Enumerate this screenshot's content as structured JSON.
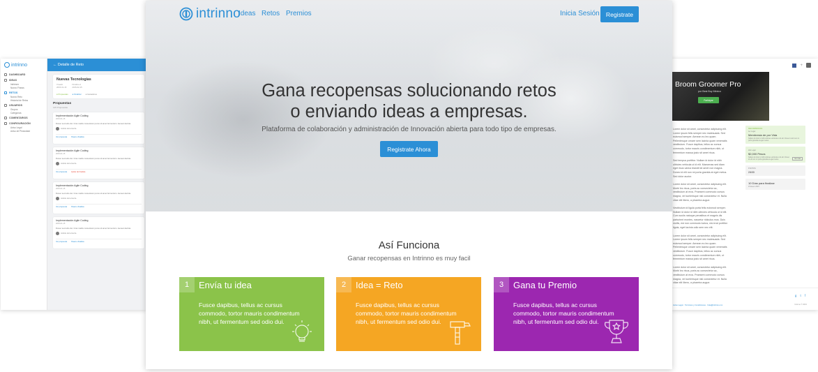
{
  "center": {
    "nav": {
      "logo": "intrinno",
      "links": [
        "Ideas",
        "Retos",
        "Premios"
      ],
      "login": "Inicia Sesión",
      "register": "Registrate"
    },
    "hero": {
      "title_line1": "Gana recopensas solucionando retos",
      "title_line2": "o enviando ideas a empresas.",
      "subtitle": "Plataforma de colaboración y administración de Innovación abierta para todo tipo de empresas.",
      "cta": "Registrate Ahora"
    },
    "how": {
      "title": "Así Funciona",
      "subtitle": "Ganar recopensas en Intrinno es muy facil",
      "steps": [
        {
          "num": "1",
          "title": "Envía tu idea",
          "desc": "Fusce dapibus, tellus ac cursus commodo, tortor mauris condimentum nibh, ut fermentum sed odio dui.",
          "color": "#8bc34a",
          "icon": "lightbulb-icon"
        },
        {
          "num": "2",
          "title": "Idea = Reto",
          "desc": "Fusce dapibus, tellus ac cursus commodo, tortor mauris condimentum nibh, ut fermentum sed odio dui.",
          "color": "#f5a623",
          "icon": "hammer-icon"
        },
        {
          "num": "3",
          "title": "Gana tu Premio",
          "desc": "Fusce dapibus, tellus ac cursus commodo, tortor mauris condimentum nibh, ut fermentum sed odio dui.",
          "color": "#9c27b0",
          "icon": "trophy-icon"
        }
      ]
    }
  },
  "left": {
    "logo": "intrinno",
    "menu": [
      {
        "label": "DASHBOARD",
        "subs": []
      },
      {
        "label": "IDEAS",
        "subs": [
          "Intrinsex",
          "Nuevo Fineas"
        ]
      },
      {
        "label": "RETOS",
        "subs": [
          "Nuevo Reto",
          "Historial de Retos"
        ],
        "active": true
      },
      {
        "label": "USUARIOS",
        "subs": [
          "Grupos",
          "Categorías"
        ]
      },
      {
        "label": "COMENTARIOS",
        "subs": []
      },
      {
        "label": "CONFIGURACIÓN",
        "subs": [
          "Aviso Legal",
          "Aviso de Privacidad"
        ]
      }
    ],
    "header": "← Detalle de Reto",
    "reto": {
      "title": "Nuevas Tecnologias",
      "meta1_label": "Creado",
      "meta1_value": "2015-01-15",
      "meta2_label": "Finaliza el",
      "meta2_value": "2015-02-15",
      "tags": [
        "Propuestas",
        "Finalizar",
        "Ganadores"
      ]
    },
    "propuestas_title": "Propuestas",
    "propuestas_sub": "125 Propuestas",
    "items": [
      {
        "title": "Implementación Agile Coding",
        "date": "2015-01-15",
        "text": "Donec sed odio dui. Cras mattis consectetur purus sit amet fermentum. Aenean lacinia.",
        "author": "Andrés de la Garza",
        "a1": "Ver propuesta",
        "a2": "Pasar a finalista",
        "red": false
      },
      {
        "title": "Implementación Agile Coding",
        "date": "2015-01-15",
        "text": "Donec sed odio dui. Cras mattis consectetur purus sit amet fermentum. Aenean lacinia.",
        "author": "Andrés de la Garza",
        "a1": "Ver propuesta",
        "a2": "Quitar de finalista",
        "red": true
      },
      {
        "title": "Implementación Agile Coding",
        "date": "2015-01-15",
        "text": "Donec sed odio dui. Cras mattis consectetur purus sit amet fermentum. Aenean lacinia.",
        "author": "Andrés de la Garza",
        "a1": "Ver propuesta",
        "a2": "Pasar a finalista",
        "red": false
      },
      {
        "title": "Implementación Agile Coding",
        "date": "2015-01-15",
        "text": "Donec sed odio dui. Cras mattis consectetur purus sit amet fermentum. Aenean lacinia.",
        "author": "Andrés de la Garza",
        "a1": "Ver propuesta",
        "a2": "Pasar a finalista",
        "red": false
      }
    ]
  },
  "right": {
    "hero_title": "Broom Groomer Pro",
    "hero_sub": "por Best Buy México",
    "hero_btn": "Participar",
    "paragraphs": [
      "Lorem dolor sit amet, consectetur adipiscing elit. Lorem ipsum felis semper nec malesuada. Sed euismod semper. Aenean eu leo quam. Pellentesque ornare sem lacinia quam venenatis vestibulum. Fusce dapibus, tellus ac cursus commodo, tortor mauris condimentum nibh, ut fermentum massa justo sit amet risus.",
      "Sed tempus porttitor. Nullam id dolor id nibh ultricies vehicula ut id elit. Maecenas sed diam eget risus varius blandit sit amet non magna. Donec id elit non mi porta gravida at eget metus. Sed dolor auctor.",
      "Lorem dolor sit amet, consectetur adipiscing elit. Morbi leo risus, porta ac consectetur ac, vestibulum at eros. Praesent commodo cursus magna, vel scelerisque nisl consectetur et. Nulla vitae elit libero, a pharetra augue.",
      "Vestibulum id ligula porta felis euismod semper. Nullam id dolor id nibh ultricies vehicula ut id elit. Cum sociis natoque penatibus et magnis dis parturient montes, nascetur ridiculus mus. Duis mollis, est non commodo luctus, nisi erat porttitor ligula, eget lacinia odio sem nec elit.",
      "Lorem dolor sit amet, consectetur adipiscing elit. Lorem ipsum felis semper nec malesuada. Sed euismod semper. Aenean eu leo quam. Pellentesque ornare sem lacinia quam venenatis vestibulum. Fusce dapibus, tellus ac cursus commodo, tortor mauris condimentum nibh, ut fermentum massa justo sit amet risus.",
      "Lorem dolor sit amet, consectetur adipiscing elit. Morbi leo risus, porta ac consectetur ac, vestibulum at eros. Praesent commodo cursus magna, vel scelerisque nisl consectetur et. Nulla vitae elit libero, a pharetra augue."
    ],
    "reward_label": "RECOMPENSAS",
    "reward1_small": "1er Lugar",
    "reward1_title": "Membresia de por Vida",
    "reward1_desc": "Nullam id dolor id nibh ultricies vehicula ut id elit. Donec id elit non mi porta gravida at eget metus.",
    "reward2_small": "2do Lugar",
    "reward2_title": "$2,000 Pesos",
    "reward2_desc": "Nullam id dolor id nibh ultricies vehicula ut id elit. Donec id elit non mi porta gravida at eget metus.",
    "reward2_link": "Ver mas",
    "points_label": "PUNTOS",
    "points_value": "2400",
    "days_value": "10 Días para finalizar",
    "days_small": "15 Enero 2015",
    "footer_links": "Aviso Legal · Términos y Condiciones · hola@intrinno.mx",
    "footer_social": "g  t  f",
    "footer_copy": "Intrinno © 2015"
  }
}
